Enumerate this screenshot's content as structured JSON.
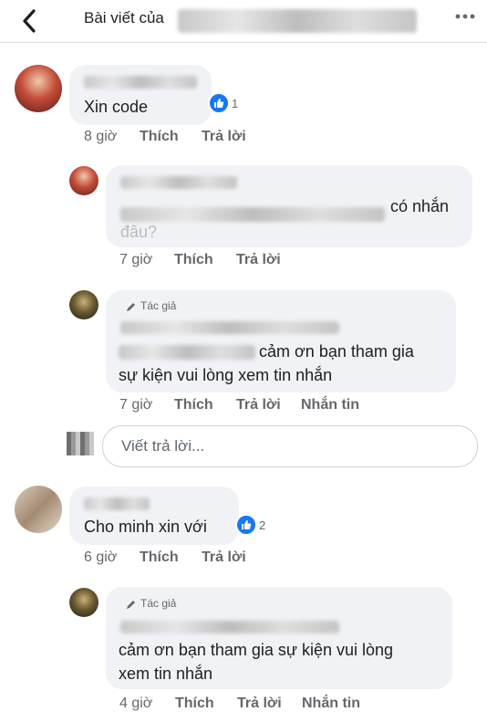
{
  "header": {
    "title_prefix": "Bài viết của",
    "back_icon": "chevron-left-icon",
    "more_icon": "more-horizontal-icon"
  },
  "comments": [
    {
      "text": "Xin code",
      "reaction_count": "1",
      "time": "8 giờ",
      "like_label": "Thích",
      "reply_label": "Trả lời"
    },
    {
      "text": "có nhắn",
      "text_line2": "đâu?",
      "time": "7 giờ",
      "like_label": "Thích",
      "reply_label": "Trả lời"
    },
    {
      "author_tag": "Tác giả",
      "text_line1": "cảm ơn bạn tham gia",
      "text_line2": "sự kiện vui lòng xem tin nhắn",
      "time": "7 giờ",
      "like_label": "Thích",
      "reply_label": "Trả lời",
      "message_label": "Nhắn tin"
    },
    {
      "text": "Cho minh xin với",
      "reaction_count": "2",
      "time": "6 giờ",
      "like_label": "Thích",
      "reply_label": "Trả lời"
    },
    {
      "author_tag": "Tác giả",
      "text_line1": "cảm ơn bạn tham gia sự kiện vui lòng",
      "text_line2": "xem tin nhắn",
      "time": "4 giờ",
      "like_label": "Thích",
      "reply_label": "Trả lời",
      "message_label": "Nhắn tin"
    }
  ],
  "reply_input": {
    "placeholder": "Viết trả lời..."
  },
  "colors": {
    "like_blue": "#1877f2",
    "bubble_bg": "#f0f2f5",
    "meta_gray": "#65676b"
  }
}
